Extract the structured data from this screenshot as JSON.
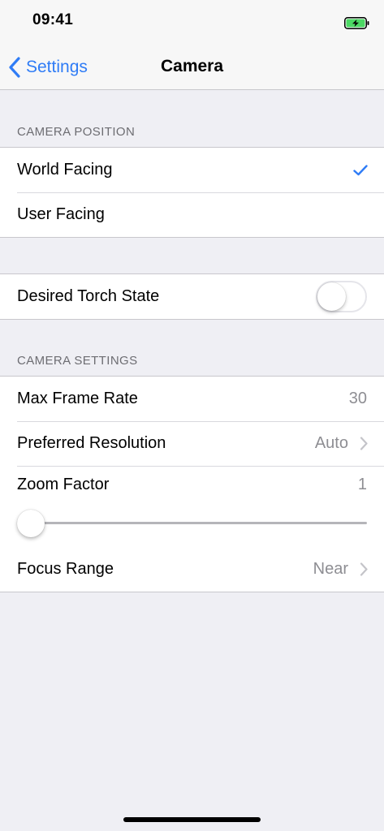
{
  "status_bar": {
    "time": "09:41",
    "battery_icon": "battery-charging-icon",
    "battery_color": "#4cd964"
  },
  "nav": {
    "back_label": "Settings",
    "title": "Camera",
    "accent_color": "#2f7cf6"
  },
  "camera_position": {
    "header": "CAMERA POSITION",
    "options": [
      {
        "label": "World Facing",
        "selected": true
      },
      {
        "label": "User Facing",
        "selected": false
      }
    ]
  },
  "torch": {
    "label": "Desired Torch State",
    "on": false
  },
  "camera_settings": {
    "header": "CAMERA SETTINGS",
    "max_frame_rate": {
      "label": "Max Frame Rate",
      "value": "30"
    },
    "preferred_resolution": {
      "label": "Preferred Resolution",
      "value": "Auto"
    },
    "zoom_factor": {
      "label": "Zoom Factor",
      "value": "1",
      "slider_fraction": 0
    },
    "focus_range": {
      "label": "Focus Range",
      "value": "Near"
    }
  }
}
